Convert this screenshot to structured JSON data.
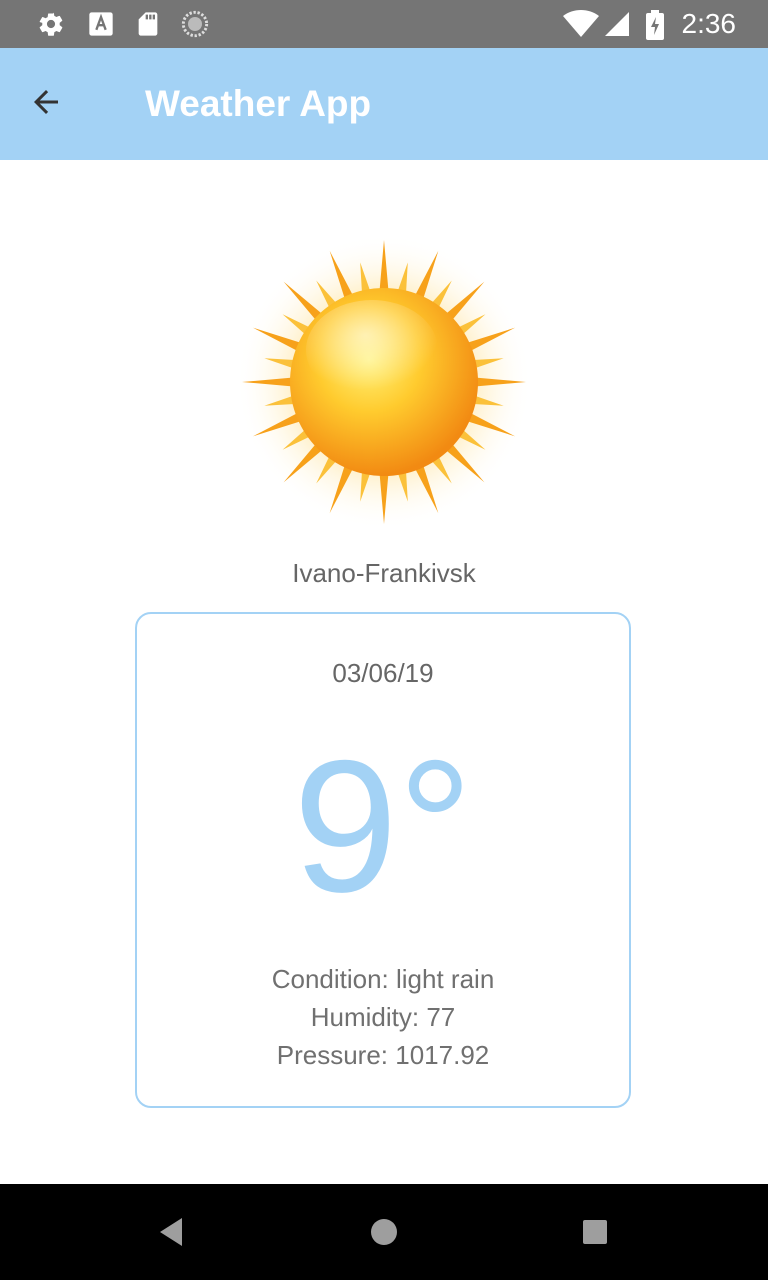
{
  "status_bar": {
    "time": "2:36",
    "left_icons": [
      "settings-icon",
      "font-a-icon",
      "sd-card-icon",
      "sync-icon"
    ],
    "right_icons": [
      "wifi-icon",
      "cellular-signal-icon",
      "battery-charging-icon"
    ]
  },
  "app_bar": {
    "title": "Weather App",
    "back_icon": "arrow-back-icon",
    "background": "#a3d2f5"
  },
  "weather": {
    "icon": "sun-icon",
    "city": "Ivano-Frankivsk",
    "date": "03/06/19",
    "temperature": "9°",
    "condition": "Condition: light rain",
    "humidity": "Humidity: 77",
    "pressure": "Pressure: 1017.92",
    "accent_color": "#a3d2f5"
  },
  "nav_bar": {
    "icons": [
      "back-triangle-icon",
      "home-circle-icon",
      "recents-square-icon"
    ]
  }
}
